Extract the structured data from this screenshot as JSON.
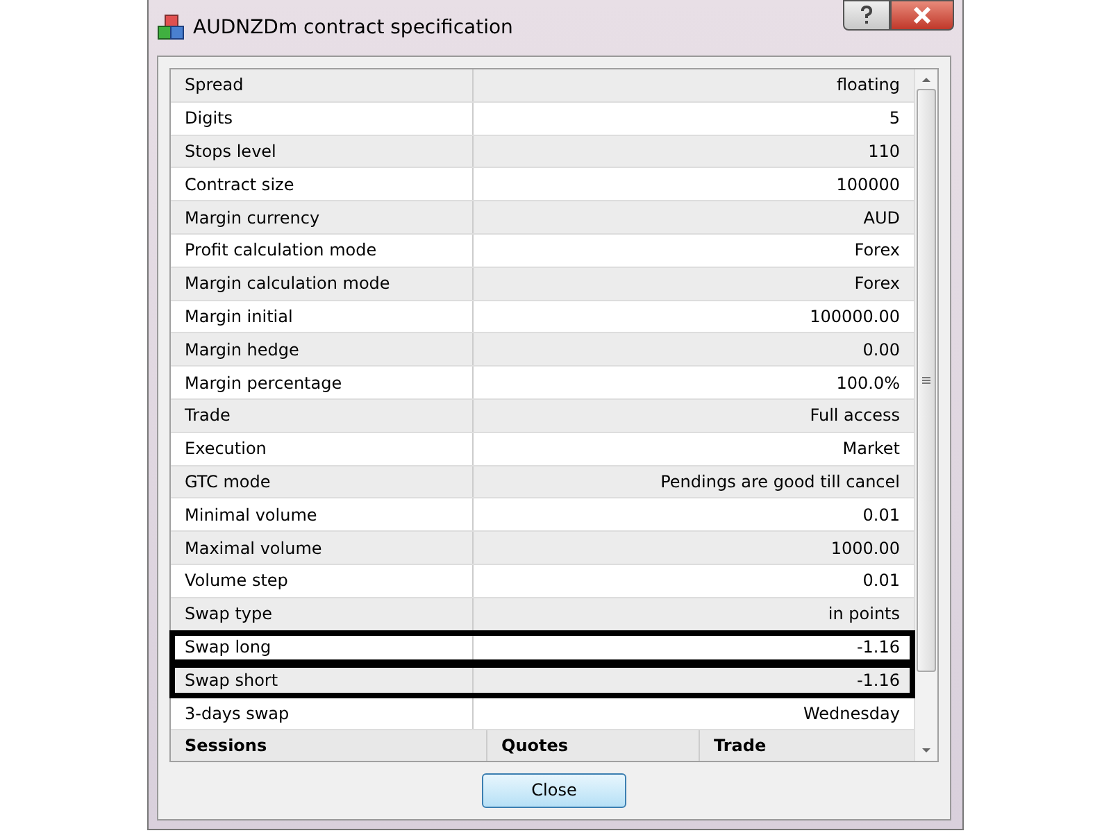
{
  "window": {
    "title": "AUDNZDm contract specification"
  },
  "rows": [
    {
      "name": "Spread",
      "value": "floating",
      "highlighted": false
    },
    {
      "name": "Digits",
      "value": "5",
      "highlighted": false
    },
    {
      "name": "Stops level",
      "value": "110",
      "highlighted": false
    },
    {
      "name": "Contract size",
      "value": "100000",
      "highlighted": false
    },
    {
      "name": "Margin currency",
      "value": "AUD",
      "highlighted": false
    },
    {
      "name": "Profit calculation mode",
      "value": "Forex",
      "highlighted": false
    },
    {
      "name": "Margin calculation mode",
      "value": "Forex",
      "highlighted": false
    },
    {
      "name": "Margin initial",
      "value": "100000.00",
      "highlighted": false
    },
    {
      "name": "Margin hedge",
      "value": "0.00",
      "highlighted": false
    },
    {
      "name": "Margin percentage",
      "value": "100.0%",
      "highlighted": false
    },
    {
      "name": "Trade",
      "value": "Full access",
      "highlighted": false
    },
    {
      "name": "Execution",
      "value": "Market",
      "highlighted": false
    },
    {
      "name": "GTC mode",
      "value": "Pendings are good till cancel",
      "highlighted": false
    },
    {
      "name": "Minimal volume",
      "value": "0.01",
      "highlighted": false
    },
    {
      "name": "Maximal volume",
      "value": "1000.00",
      "highlighted": false
    },
    {
      "name": "Volume step",
      "value": "0.01",
      "highlighted": false
    },
    {
      "name": "Swap type",
      "value": "in points",
      "highlighted": false
    },
    {
      "name": "Swap long",
      "value": "-1.16",
      "highlighted": true
    },
    {
      "name": "Swap short",
      "value": "-1.16",
      "highlighted": true
    },
    {
      "name": "3-days swap",
      "value": "Wednesday",
      "highlighted": false
    }
  ],
  "sessions_header": [
    "Sessions",
    "Quotes",
    "Trade"
  ],
  "buttons": [
    "Close"
  ]
}
